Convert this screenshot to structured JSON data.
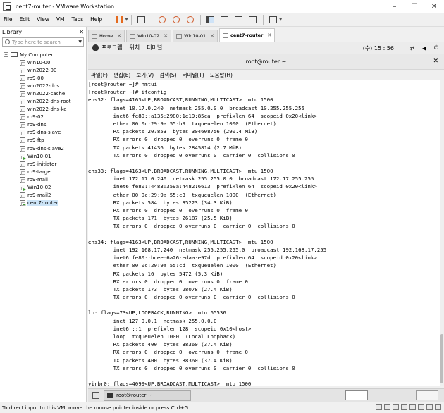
{
  "window": {
    "title": "cent7-router - VMware Workstation"
  },
  "menu": [
    "File",
    "Edit",
    "View",
    "VM",
    "Tabs",
    "Help"
  ],
  "library": {
    "title": "Library",
    "search_placeholder": "Type here to search",
    "root": "My Computer",
    "items": [
      "win10-00",
      "win2022-00",
      "ro9-00",
      "win2022-dns",
      "win2022-cache",
      "win2022-dns-root",
      "win2022-dns-ke",
      "ro9-02",
      "ro9-dns",
      "ro9-dns-slave",
      "ro9-ftp",
      "ro9-dns-slave2",
      "Win10-01",
      "ro9-initiator",
      "ro9-target",
      "ro9-mail",
      "Win10-02",
      "ro9-mail2",
      "cent7-router"
    ]
  },
  "tabs": [
    {
      "label": "Home"
    },
    {
      "label": "Win10-02"
    },
    {
      "label": "Win10-01"
    },
    {
      "label": "cent7-router"
    }
  ],
  "gnome": {
    "apps": "프로그램",
    "places": "위치",
    "terminal": "터미널",
    "time": "(수) 15 : 56"
  },
  "terminal": {
    "title": "root@router:~",
    "menu": [
      "파일(F)",
      "편집(E)",
      "보기(V)",
      "검색(S)",
      "터미널(T)",
      "도움말(H)"
    ],
    "lines": [
      "[root@router ~]# nmtui",
      "[root@router ~]# ifconfig",
      "ens32: flags=4163<UP,BROADCAST,RUNNING,MULTICAST>  mtu 1500",
      "        inet 10.17.0.240  netmask 255.0.0.0  broadcast 10.255.255.255",
      "        inet6 fe80::a135:2980:1e19:85ca  prefixlen 64  scopeid 0x20<link>",
      "        ether 00:0c:29:9a:55:b9  txqueuelen 1000  (Ethernet)",
      "        RX packets 207853  bytes 304608756 (290.4 MiB)",
      "        RX errors 0  dropped 0  overruns 0  frame 0",
      "        TX packets 41436  bytes 2845814 (2.7 MiB)",
      "        TX errors 0  dropped 0 overruns 0  carrier 0  collisions 0",
      "",
      "ens33: flags=4163<UP,BROADCAST,RUNNING,MULTICAST>  mtu 1500",
      "        inet 172.17.0.240  netmask 255.255.0.0  broadcast 172.17.255.255",
      "        inet6 fe80::4483:359a:4482:6613  prefixlen 64  scopeid 0x20<link>",
      "        ether 00:0c:29:9a:55:c3  txqueuelen 1000  (Ethernet)",
      "        RX packets 584  bytes 35223 (34.3 KiB)",
      "        RX errors 0  dropped 0  overruns 0  frame 0",
      "        TX packets 171  bytes 26187 (25.5 KiB)",
      "        TX errors 0  dropped 0 overruns 0  carrier 0  collisions 0",
      "",
      "ens34: flags=4163<UP,BROADCAST,RUNNING,MULTICAST>  mtu 1500",
      "        inet 192.168.17.240  netmask 255.255.255.0  broadcast 192.168.17.255",
      "        inet6 fe80::bcee:6a26:edaa:e97d  prefixlen 64  scopeid 0x20<link>",
      "        ether 00:0c:29:9a:55:cd  txqueuelen 1000  (Ethernet)",
      "        RX packets 16  bytes 5472 (5.3 KiB)",
      "        RX errors 0  dropped 0  overruns 0  frame 0",
      "        TX packets 173  bytes 28078 (27.4 KiB)",
      "        TX errors 0  dropped 0 overruns 0  carrier 0  collisions 0",
      "",
      "lo: flags=73<UP,LOOPBACK,RUNNING>  mtu 65536",
      "        inet 127.0.0.1  netmask 255.0.0.0",
      "        inet6 ::1  prefixlen 128  scopeid 0x10<host>",
      "        loop  txqueuelen 1000  (Local Loopback)",
      "        RX packets 400  bytes 38360 (37.4 KiB)",
      "        RX errors 0  dropped 0  overruns 0  frame 0",
      "        TX packets 400  bytes 38360 (37.4 KiB)",
      "        TX errors 0  dropped 0 overruns 0  carrier 0  collisions 0",
      "",
      "virbr0: flags=4099<UP,BROADCAST,MULTICAST>  mtu 1500"
    ]
  },
  "taskbar": {
    "item": "root@router:~"
  },
  "status": {
    "text": "To direct input to this VM, move the mouse pointer inside or press Ctrl+G."
  },
  "icons": {
    "pause": "pause-icon",
    "snapshot": "snapshot-icon",
    "fullscreen": "fullscreen-icon",
    "library_close": "close-icon",
    "search": "search-icon",
    "network": "network-icon",
    "volume": "volume-icon",
    "power": "power-icon"
  },
  "colors": {
    "accent": "#e46a1e",
    "selected": "#cce4f7",
    "running": "#3c9a2f"
  }
}
